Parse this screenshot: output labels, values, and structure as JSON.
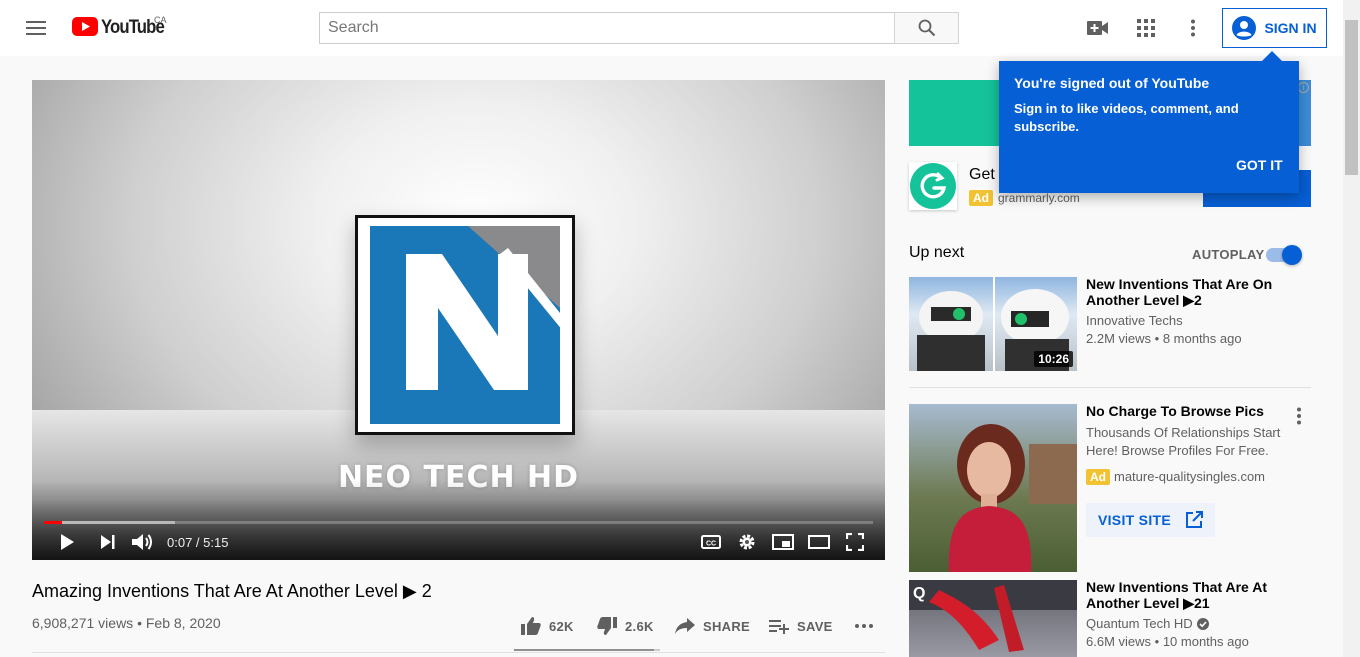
{
  "header": {
    "logo_text": "YouTube",
    "country_code": "CA",
    "search_placeholder": "Search",
    "sign_in_label": "SIGN IN"
  },
  "tooltip": {
    "title": "You're signed out of YouTube",
    "body": "Sign in to like videos, comment, and subscribe.",
    "button": "GOT IT"
  },
  "player": {
    "brand_text": "NEO TECH HD",
    "time_current": "0:07",
    "time_separator": " / ",
    "time_total": "5:15",
    "progress_played_fraction": 0.022,
    "progress_buffered_fraction": 0.158
  },
  "video": {
    "title": "Amazing Inventions That Are At Another Level ▶ 2",
    "views": "6,908,271 views",
    "meta_separator": " • ",
    "date": "Feb 8, 2020",
    "likes": "62K",
    "dislikes": "2.6K",
    "share_label": "SHARE",
    "save_label": "SAVE",
    "like_ratio": 0.96
  },
  "ad": {
    "title": "Get",
    "badge": "Ad",
    "domain": "grammarly.com"
  },
  "sidebar": {
    "up_next_label": "Up next",
    "autoplay_label": "AUTOPLAY",
    "autoplay_on": true,
    "items": [
      {
        "title": "New Inventions That Are On Another Level ▶2",
        "channel": "Innovative Techs",
        "views": "2.2M views",
        "age": "8 months ago",
        "duration": "10:26"
      },
      {
        "title": "No Charge To Browse Pics",
        "description": "Thousands Of Relationships Start Here! Browse Profiles For Free.",
        "badge": "Ad",
        "domain": "mature-qualitysingles.com",
        "cta": "VISIT SITE"
      },
      {
        "title": "New Inventions That Are At Another Level ▶21",
        "channel": "Quantum Tech HD",
        "views": "6.6M views",
        "age": "10 months ago"
      }
    ]
  },
  "colors": {
    "youtube_red": "#ff0000",
    "accent_blue": "#065fd4",
    "ad_badge": "#f1c232",
    "grammarly_green": "#15c39a"
  },
  "icons": [
    "menu-icon",
    "youtube-play-logo-icon",
    "search-icon",
    "create-video-icon",
    "apps-grid-icon",
    "more-vert-icon",
    "account-circle-icon",
    "play-icon",
    "next-icon",
    "volume-icon",
    "captions-icon",
    "settings-gear-icon",
    "miniplayer-icon",
    "theater-mode-icon",
    "fullscreen-icon",
    "thumb-up-icon",
    "thumb-down-icon",
    "share-arrow-icon",
    "playlist-add-icon",
    "more-horiz-icon",
    "info-icon",
    "open-in-new-icon",
    "verified-check-icon"
  ]
}
